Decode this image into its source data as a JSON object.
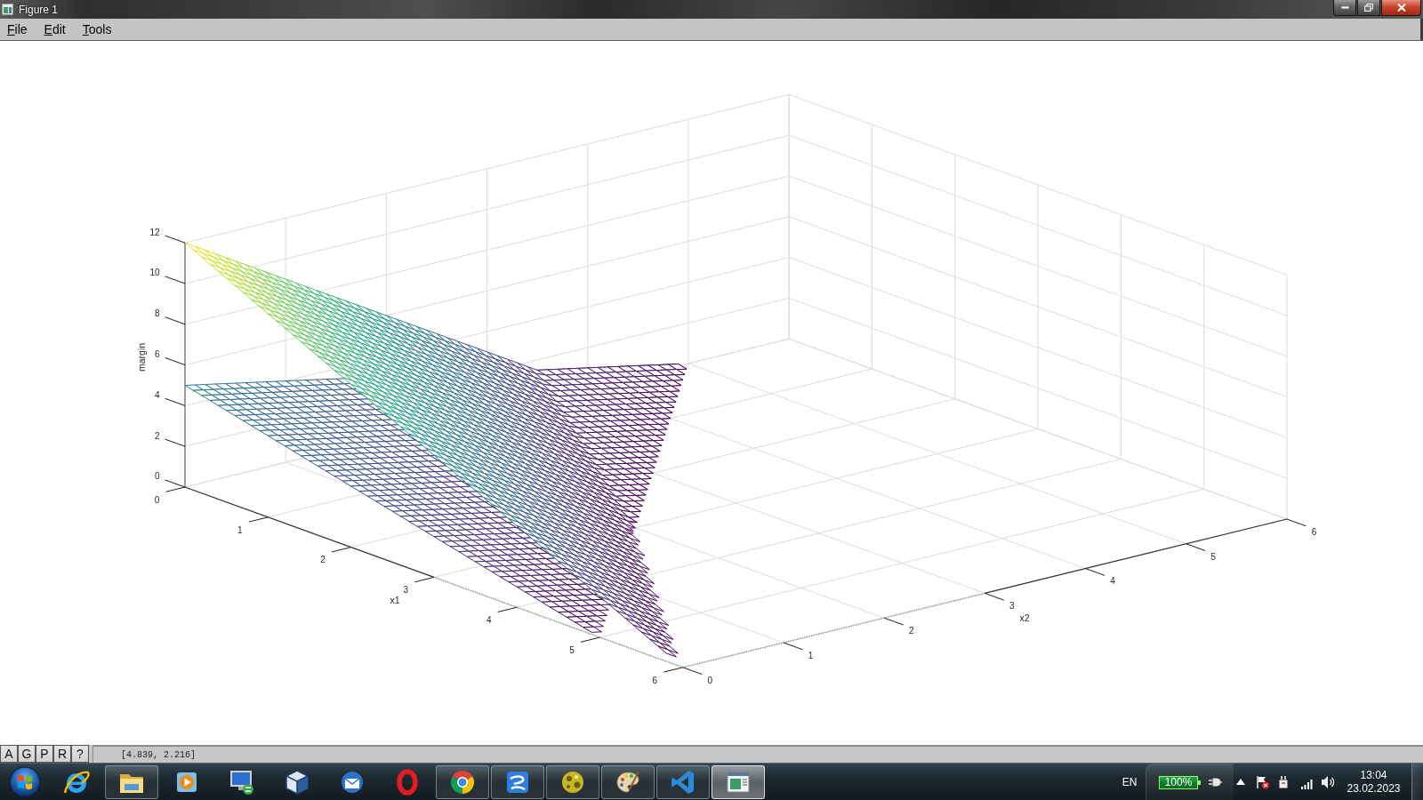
{
  "window": {
    "title": "Figure 1"
  },
  "menu": [
    "File",
    "Edit",
    "Tools"
  ],
  "plot": {
    "zlabel": "margin",
    "xlabel": "x1",
    "ylabel": "x2",
    "z_ticks": [
      "12",
      "10",
      "8",
      "6",
      "4",
      "2",
      "0"
    ],
    "x_ticks": [
      "0",
      "1",
      "2",
      "3",
      "4",
      "5",
      "6"
    ],
    "y_ticks": [
      "0",
      "1",
      "2",
      "3",
      "4",
      "5",
      "6"
    ]
  },
  "toolbar": {
    "buttons": [
      "A",
      "G",
      "P",
      "R",
      "?"
    ],
    "status": "[4.839, 2.216]"
  },
  "taskbar": {
    "apps": [
      {
        "running": false,
        "selected": false
      },
      {
        "running": true,
        "selected": false
      },
      {
        "running": false,
        "selected": false
      },
      {
        "running": false,
        "selected": false
      },
      {
        "running": false,
        "selected": false
      },
      {
        "running": false,
        "selected": false
      },
      {
        "running": false,
        "selected": false
      },
      {
        "running": true,
        "selected": false
      },
      {
        "running": true,
        "selected": false
      },
      {
        "running": true,
        "selected": false
      },
      {
        "running": true,
        "selected": false
      },
      {
        "running": true,
        "selected": false
      },
      {
        "running": true,
        "selected": true
      }
    ],
    "tray": {
      "language": "EN",
      "battery": "100%",
      "time": "13:04",
      "date": "23.02.2023"
    }
  }
}
